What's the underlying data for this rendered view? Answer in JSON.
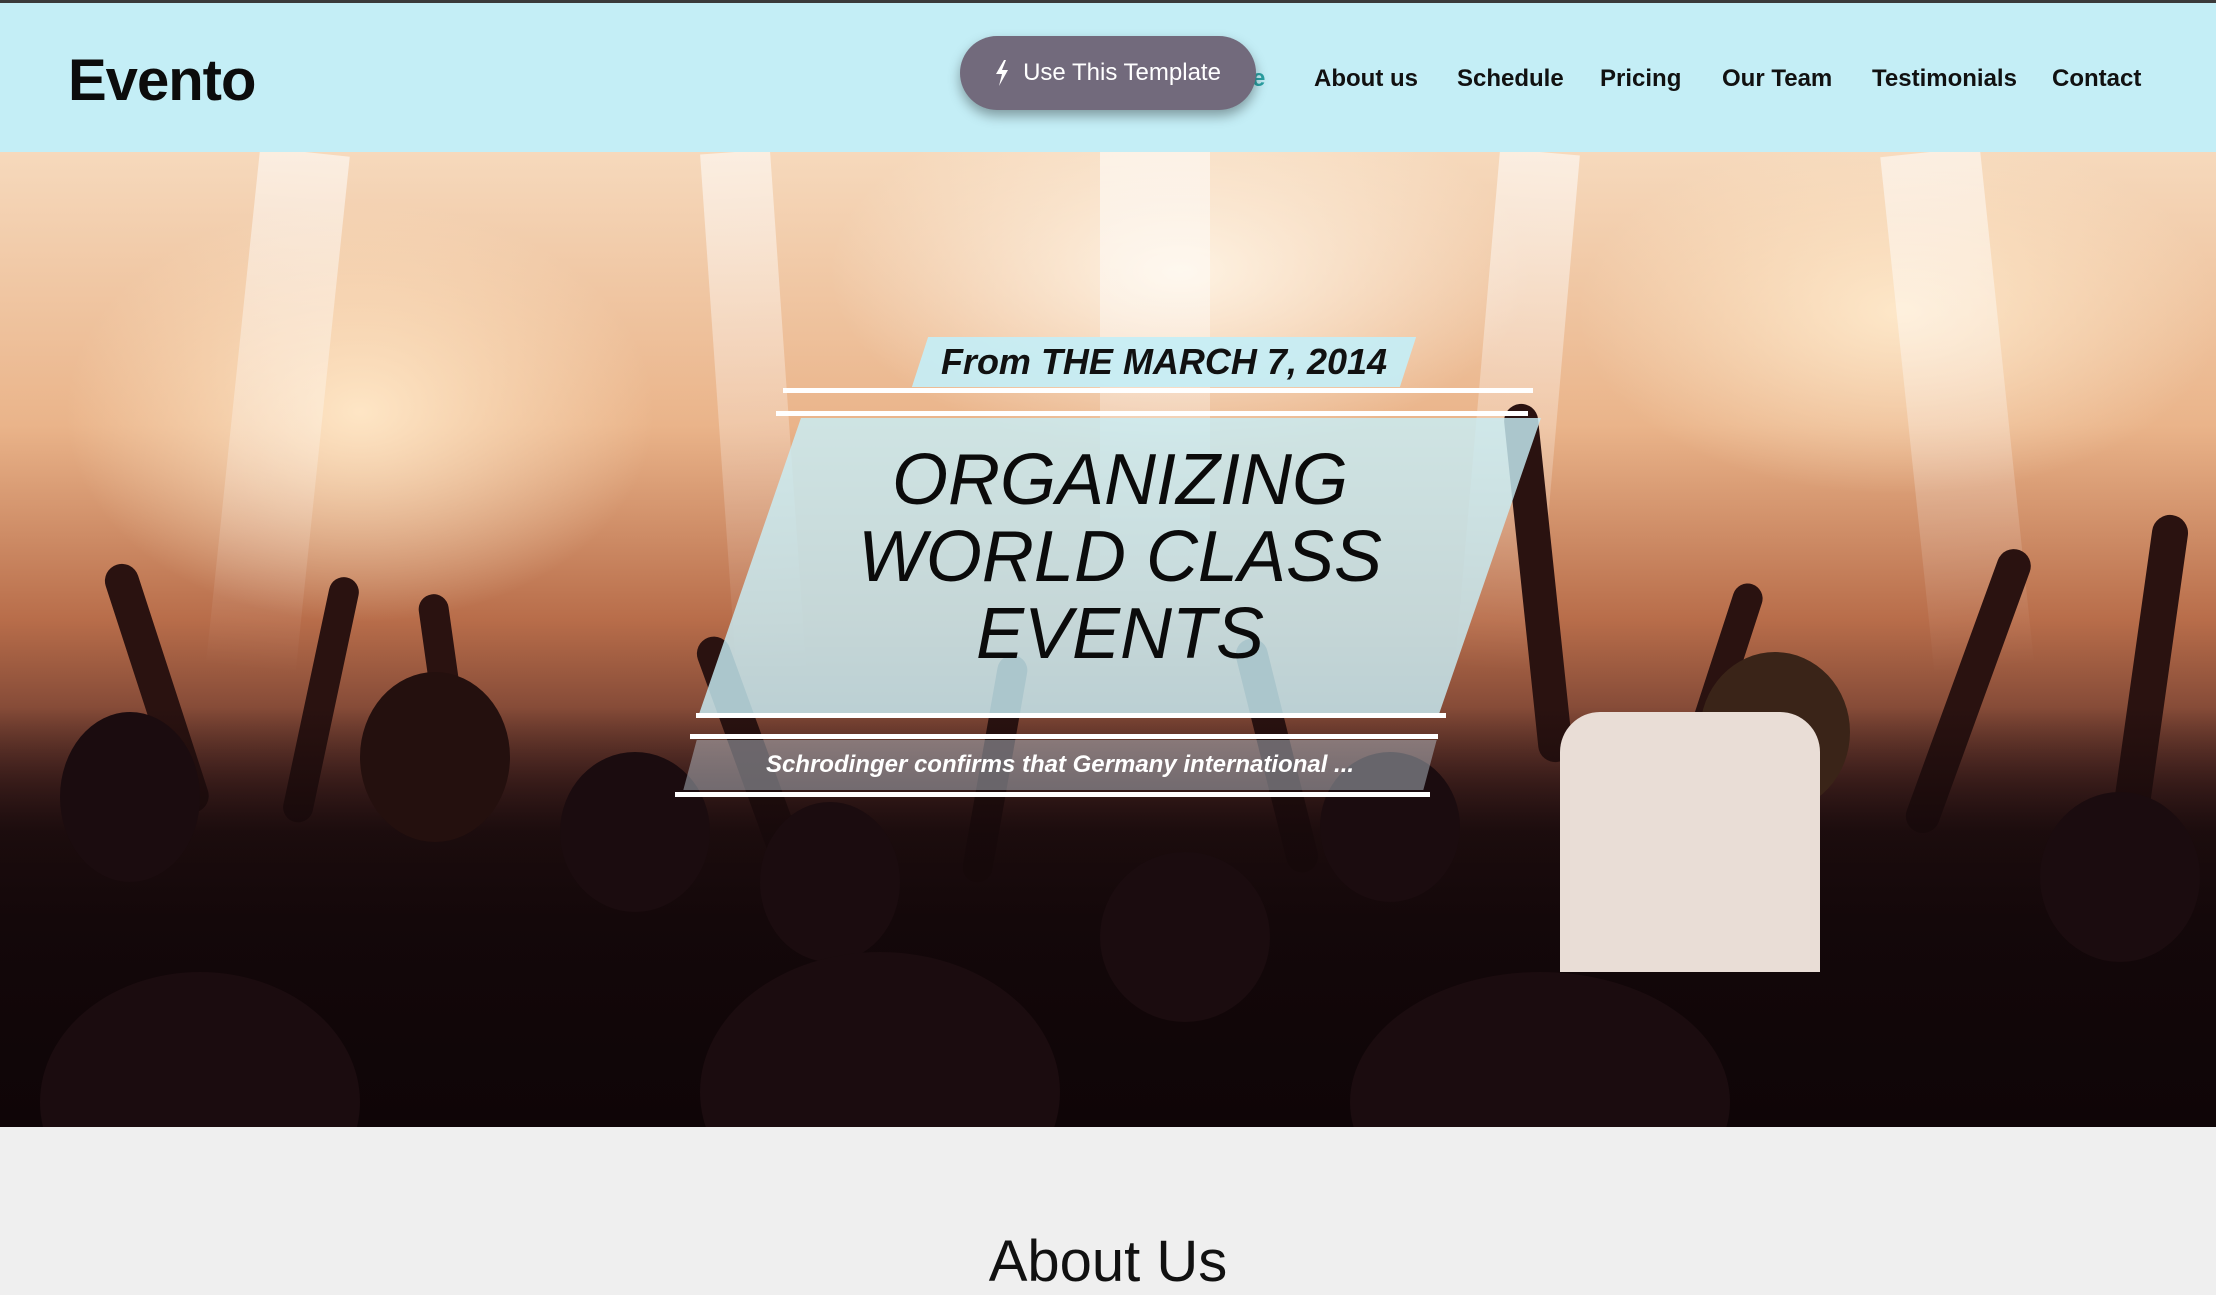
{
  "header": {
    "logo": "Evento",
    "nav": [
      {
        "label": "e"
      },
      {
        "label": "About us"
      },
      {
        "label": "Schedule"
      },
      {
        "label": "Pricing"
      },
      {
        "label": "Our Team"
      },
      {
        "label": "Testimonials"
      },
      {
        "label": "Contact"
      }
    ],
    "template_button": "Use This Template",
    "accent_color": "#2aa2a4",
    "bg_color": "#c4eef6"
  },
  "hero": {
    "date": "From THE MARCH 7, 2014",
    "title_lines": [
      "ORGANIZING",
      "WORLD CLASS",
      "EVENTS"
    ],
    "subtitle": "Schrodinger confirms that Germany international ..."
  },
  "about": {
    "heading": "About Us"
  }
}
